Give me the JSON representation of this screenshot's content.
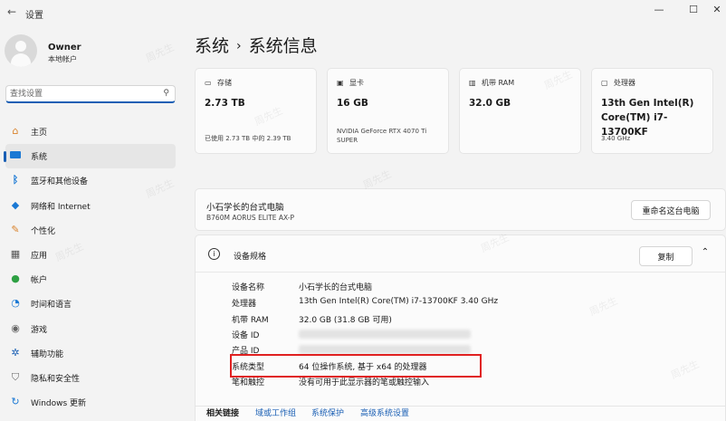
{
  "window": {
    "title": "设置"
  },
  "user": {
    "name": "Owner",
    "account_type": "本地帐户"
  },
  "search": {
    "placeholder": "查找设置"
  },
  "nav": [
    {
      "label": "主页",
      "icon": "home-icon"
    },
    {
      "label": "系统",
      "icon": "system-icon",
      "active": true
    },
    {
      "label": "蓝牙和其他设备",
      "icon": "bluetooth-icon"
    },
    {
      "label": "网络和 Internet",
      "icon": "network-icon"
    },
    {
      "label": "个性化",
      "icon": "personalization-icon"
    },
    {
      "label": "应用",
      "icon": "apps-icon"
    },
    {
      "label": "帐户",
      "icon": "account-icon"
    },
    {
      "label": "时间和语言",
      "icon": "time-language-icon"
    },
    {
      "label": "游戏",
      "icon": "gaming-icon"
    },
    {
      "label": "辅助功能",
      "icon": "accessibility-icon"
    },
    {
      "label": "隐私和安全性",
      "icon": "privacy-shield-icon"
    },
    {
      "label": "Windows 更新",
      "icon": "windows-update-icon"
    }
  ],
  "breadcrumb": {
    "parent": "系统",
    "separator": "›",
    "current": "系统信息"
  },
  "cards": [
    {
      "title": "存储",
      "icon": "storage-icon",
      "value": "2.73 TB",
      "sub": "已使用 2.73 TB 中的 2.39 TB"
    },
    {
      "title": "显卡",
      "icon": "gpu-icon",
      "value": "16 GB",
      "sub": "NVIDIA GeForce RTX 4070 Ti SUPER"
    },
    {
      "title": "机带 RAM",
      "icon": "ram-icon",
      "value": "32.0 GB",
      "sub": ""
    },
    {
      "title": "处理器",
      "icon": "cpu-icon",
      "value": "13th Gen Intel(R) Core(TM) i7-13700KF",
      "sub": "3.40 GHz"
    }
  ],
  "pc": {
    "name": "小石学长的台式电脑",
    "model": "B760M AORUS ELITE AX-P",
    "rename_label": "重命名这台电脑"
  },
  "specs": {
    "title": "设备规格",
    "copy_label": "复制",
    "rows": [
      {
        "key": "设备名称",
        "value": "小石学长的台式电脑"
      },
      {
        "key": "处理器",
        "value": "13th Gen Intel(R) Core(TM) i7-13700KF   3.40 GHz"
      },
      {
        "key": "机带 RAM",
        "value": "32.0 GB (31.8 GB 可用)"
      },
      {
        "key": "设备 ID",
        "value": ""
      },
      {
        "key": "产品 ID",
        "value": ""
      },
      {
        "key": "系统类型",
        "value": "64 位操作系统, 基于 x64 的处理器"
      },
      {
        "key": "笔和触控",
        "value": "没有可用于此显示器的笔或触控输入"
      }
    ]
  },
  "related": {
    "title": "相关链接",
    "links": [
      "域或工作组",
      "系统保护",
      "高级系统设置"
    ]
  },
  "watermark": "周先生"
}
